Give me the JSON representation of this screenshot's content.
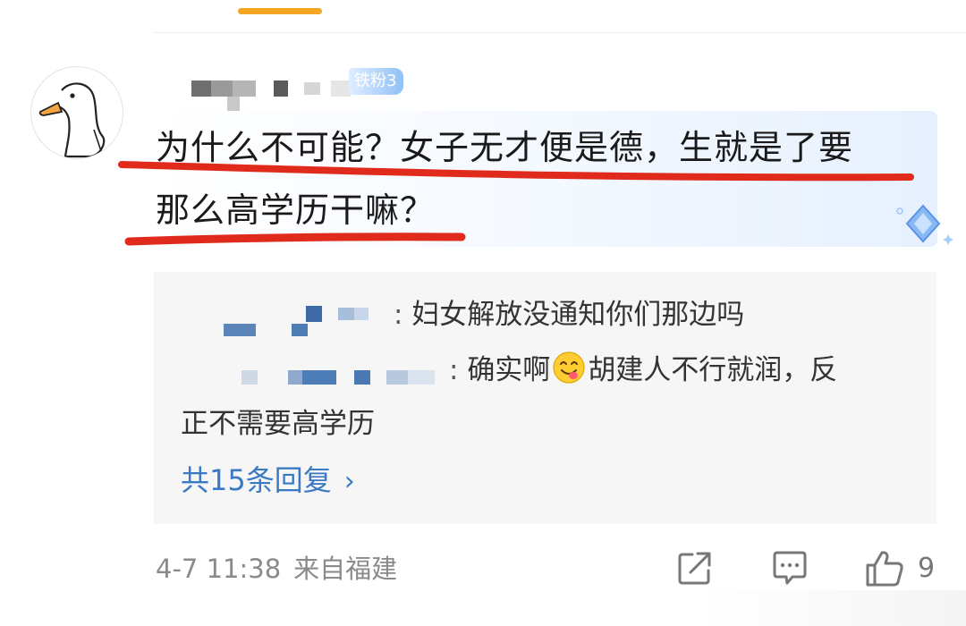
{
  "comment": {
    "fan_badge": "铁粉3",
    "text_line1": "为什么不可能？女子无才便是德，生就是了要",
    "text_line2": "那么高学历干嘛？"
  },
  "replies": [
    {
      "separator": ":",
      "text": "妇女解放没通知你们那边吗"
    },
    {
      "separator": ":",
      "text_before_emoji": "确实啊",
      "emoji": "yum-face-emoji",
      "text_after_emoji_line1": "胡建人不行就润，反",
      "text_line2": "正不需要高学历"
    }
  ],
  "more_replies": {
    "label": "共15条回复",
    "chevron": "›"
  },
  "meta": {
    "date_time": "4-7 11:38",
    "location": "来自福建"
  },
  "actions": {
    "share_icon": "share-icon",
    "comment_icon": "comment-icon",
    "like_icon": "thumbs-up-icon",
    "like_count": "9"
  },
  "colors": {
    "accent_blue": "#3a79c4",
    "highlight_red": "#e02b1c",
    "tab_indicator": "#f5a623",
    "reply_background": "#f6f6f6"
  }
}
